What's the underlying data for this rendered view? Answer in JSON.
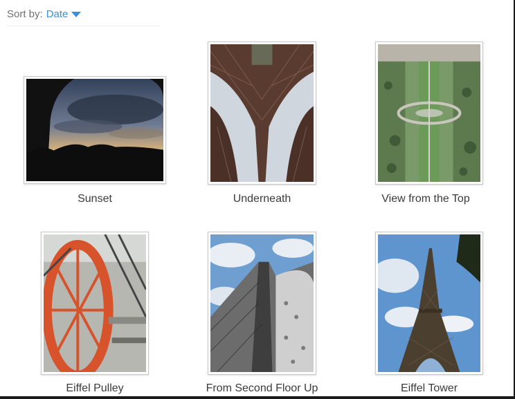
{
  "sort": {
    "label": "Sort by:",
    "value": "Date"
  },
  "photos": [
    {
      "caption": "Sunset"
    },
    {
      "caption": "Underneath"
    },
    {
      "caption": "View from the Top"
    },
    {
      "caption": "Eiffel Pulley"
    },
    {
      "caption": "From Second Floor Up"
    },
    {
      "caption": "Eiffel Tower"
    }
  ]
}
